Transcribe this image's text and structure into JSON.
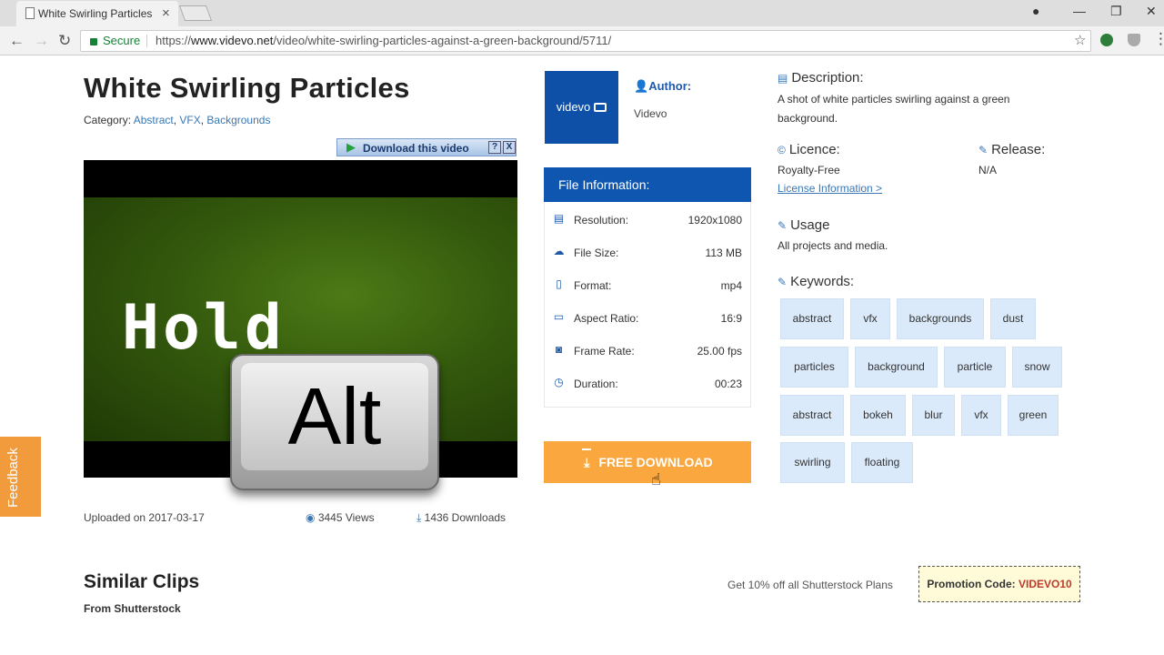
{
  "browser": {
    "tab_title": "White Swirling Particles a",
    "close_glyph": "×",
    "secure_label": "Secure",
    "url_scheme": "https://",
    "url_domain": "www.videvo.net",
    "url_path": "/video/white-swirling-particles-against-a-green-background/5711/"
  },
  "video_page": {
    "title": "White Swirling Particles",
    "category_label": "Category:",
    "categories": [
      "Abstract",
      "VFX",
      "Backgrounds"
    ],
    "download_video_label": "Download this video",
    "help_glyph": "?",
    "close_glyph": "X",
    "overlay_hold": "Hold",
    "overlay_key": "Alt",
    "uploaded": "Uploaded on 2017-03-17",
    "views": "3445 Views",
    "downloads": "1436 Downloads",
    "feedback_label": "Feedback"
  },
  "author": {
    "logo_text": "videvo",
    "label": "Author:",
    "name": "Videvo"
  },
  "file_info": {
    "heading": "File Information:",
    "rows": [
      {
        "key": "Resolution:",
        "value": "1920x1080"
      },
      {
        "key": "File Size:",
        "value": "113 MB"
      },
      {
        "key": "Format:",
        "value": "mp4"
      },
      {
        "key": "Aspect Ratio:",
        "value": "16:9"
      },
      {
        "key": "Frame Rate:",
        "value": "25.00 fps"
      },
      {
        "key": "Duration:",
        "value": "00:23"
      }
    ]
  },
  "download_button": "FREE DOWNLOAD",
  "details": {
    "description_label": "Description:",
    "description_text": "A shot of white particles swirling against a green background.",
    "licence_label": "Licence:",
    "licence_value": "Royalty-Free",
    "licence_link": "License Information >",
    "release_label": "Release:",
    "release_value": "N/A",
    "usage_label": "Usage",
    "usage_value": "All projects and media.",
    "keywords_label": "Keywords:"
  },
  "keywords": [
    "abstract",
    "vfx",
    "backgrounds",
    "dust",
    "particles",
    "background",
    "particle",
    "snow",
    "abstract",
    "bokeh",
    "blur",
    "vfx",
    "green",
    "swirling",
    "floating"
  ],
  "similar": {
    "heading": "Similar Clips",
    "source": "From Shutterstock",
    "promo_text": "Get 10% off all Shutterstock Plans",
    "promo_label": "Promotion Code:",
    "promo_code": "VIDEVO10"
  },
  "colors": {
    "brand_blue": "#0e56b0",
    "download_orange": "#f9a73e",
    "feedback_orange": "#f29b3d",
    "link_blue": "#3a77b5",
    "keyword_bg": "#dbeafb"
  }
}
